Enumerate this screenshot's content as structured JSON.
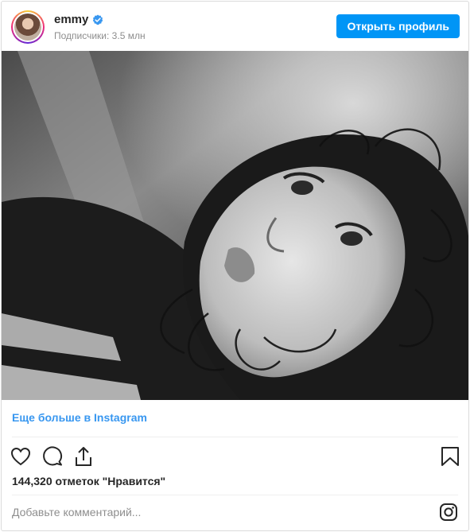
{
  "header": {
    "username": "emmy",
    "followers": "Подписчики: 3.5 млн",
    "open_profile_label": "Открыть профиль",
    "verified_icon": "verified-badge-icon",
    "accent_color": "#0095f6"
  },
  "post": {
    "more_link": "Еще больше в Instagram",
    "likes": "144,320 отметок \"Нравится\"",
    "comment_placeholder": "Добавьте комментарий..."
  },
  "actions": {
    "icons": [
      "heart-icon",
      "comment-icon",
      "share-icon",
      "bookmark-icon"
    ]
  },
  "footer": {
    "icon": "instagram-icon"
  }
}
